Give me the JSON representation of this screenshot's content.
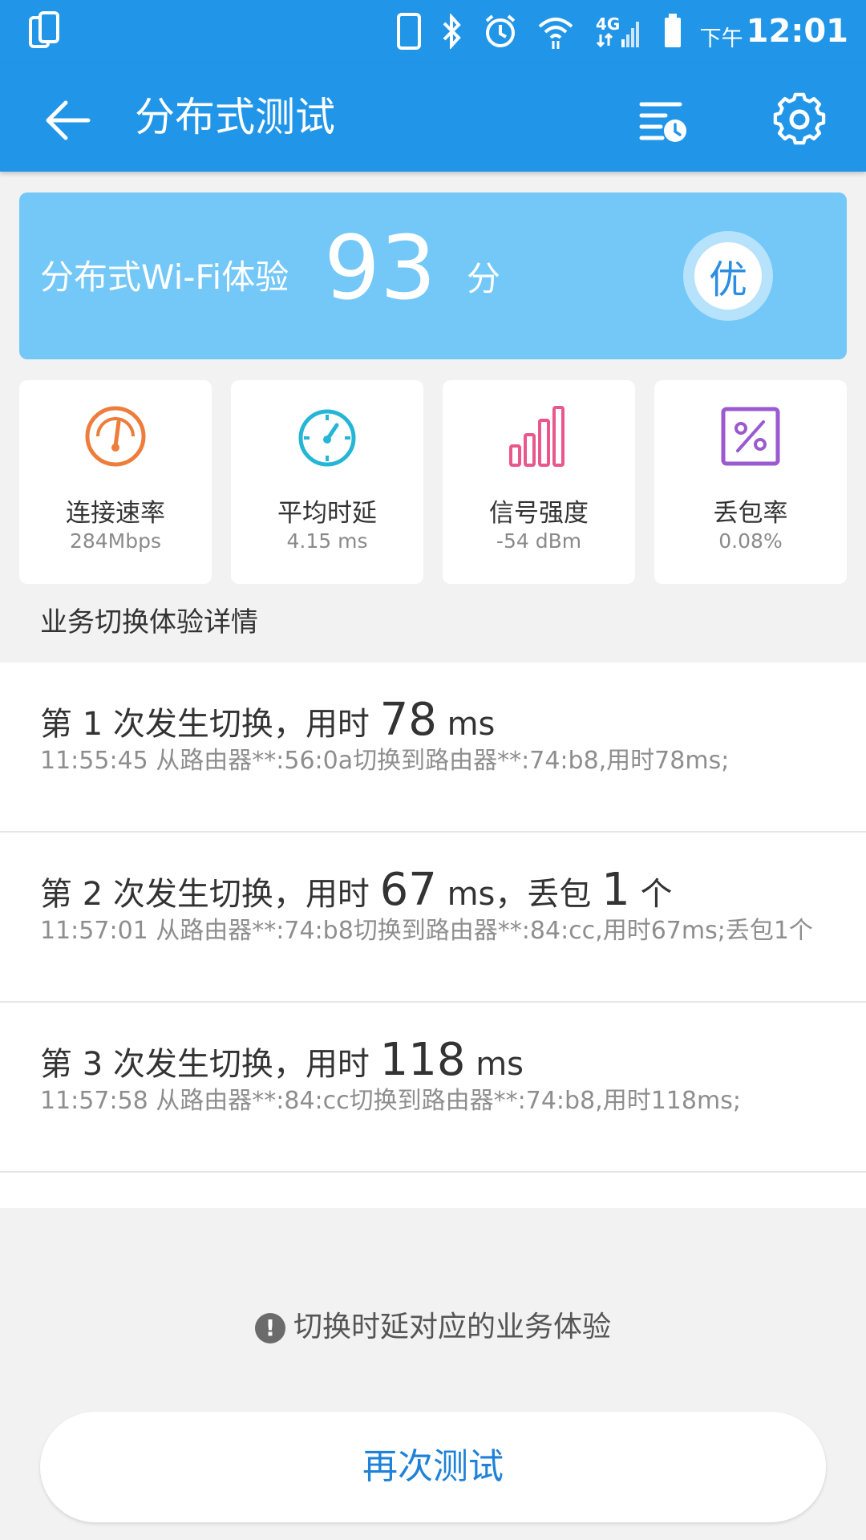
{
  "status_bar": {
    "time_prefix": "下午",
    "time": "12:01",
    "network": "4G"
  },
  "app_bar": {
    "title": "分布式测试"
  },
  "score_card": {
    "label": "分布式Wi-Fi体验",
    "score": "93",
    "unit": "分",
    "grade": "优"
  },
  "metrics": [
    {
      "label": "连接速率",
      "value": "284Mbps",
      "icon": "speedometer-icon",
      "color": "#ee7d3b"
    },
    {
      "label": "平均时延",
      "value": "4.15 ms",
      "icon": "stopwatch-icon",
      "color": "#25b6d6"
    },
    {
      "label": "信号强度",
      "value": "-54 dBm",
      "icon": "signal-bars-icon",
      "color": "#e9578c"
    },
    {
      "label": "丢包率",
      "value": "0.08%",
      "icon": "percent-icon",
      "color": "#9b5ad0"
    }
  ],
  "section_title": "业务切换体验详情",
  "switch_events": [
    {
      "prefix": "第 1 次发生切换，用时 ",
      "duration": "78",
      "unit": " ms",
      "loss_text": "",
      "loss_count": "",
      "loss_unit": "",
      "detail": "11:55:45 从路由器**:56:0a切换到路由器**:74:b8,用时78ms;"
    },
    {
      "prefix": "第 2 次发生切换，用时 ",
      "duration": "67",
      "unit": " ms",
      "loss_text": "，丢包 ",
      "loss_count": "1",
      "loss_unit": " 个",
      "detail": "11:57:01 从路由器**:74:b8切换到路由器**:84:cc,用时67ms;丢包1个"
    },
    {
      "prefix": "第 3 次发生切换，用时 ",
      "duration": "118",
      "unit": " ms",
      "loss_text": "",
      "loss_count": "",
      "loss_unit": "",
      "detail": "11:57:58 从路由器**:84:cc切换到路由器**:74:b8,用时118ms;"
    }
  ],
  "info_link": "切换时延对应的业务体验",
  "retest_button": "再次测试"
}
